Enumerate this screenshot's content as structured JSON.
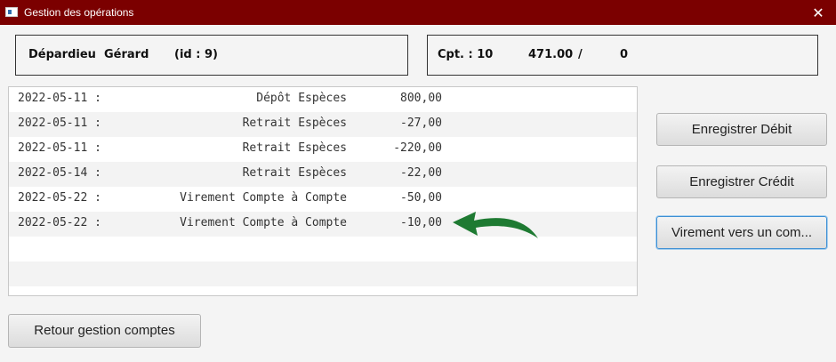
{
  "window": {
    "title": "Gestion des opérations",
    "close_glyph": "✕",
    "titlebar_color": "#7b0000"
  },
  "client": {
    "name": "Dépardieu  Gérard",
    "id_text": "(id : 9)"
  },
  "account": {
    "label": "Cpt. : 10",
    "balance": "471.00",
    "separator": "/",
    "overdraft": "0"
  },
  "operations": [
    {
      "date": "2022-05-11 :",
      "label": "Dépôt Espèces",
      "amount": "800,00"
    },
    {
      "date": "2022-05-11 :",
      "label": "Retrait Espèces",
      "amount": "-27,00"
    },
    {
      "date": "2022-05-11 :",
      "label": "Retrait Espèces",
      "amount": "-220,00"
    },
    {
      "date": "2022-05-14 :",
      "label": "Retrait Espèces",
      "amount": "-22,00"
    },
    {
      "date": "2022-05-22 :",
      "label": "Virement Compte à Compte",
      "amount": "-50,00"
    },
    {
      "date": "2022-05-22 :",
      "label": "Virement Compte à Compte",
      "amount": "-10,00"
    }
  ],
  "buttons": {
    "debit": "Enregistrer Débit",
    "credit": "Enregistrer Crédit",
    "transfer": "Virement vers un com...",
    "back": "Retour gestion comptes"
  },
  "annotation": {
    "icon": "curved-arrow-icon",
    "color": "#1e7a32"
  }
}
